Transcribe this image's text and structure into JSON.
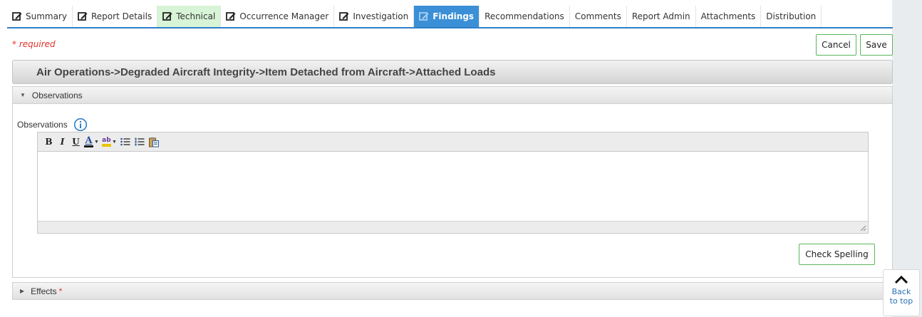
{
  "tabs": [
    {
      "label": "Summary",
      "icon": "edit-icon",
      "state": "normal"
    },
    {
      "label": "Report Details",
      "icon": "edit-icon",
      "state": "normal"
    },
    {
      "label": "Technical",
      "icon": "edit-icon",
      "state": "green"
    },
    {
      "label": "Occurrence Manager",
      "icon": "edit-icon",
      "state": "normal"
    },
    {
      "label": "Investigation",
      "icon": "edit-icon",
      "state": "normal"
    },
    {
      "label": "Findings",
      "icon": "edit-icon",
      "state": "active"
    },
    {
      "label": "Recommendations",
      "state": "normal"
    },
    {
      "label": "Comments",
      "state": "normal"
    },
    {
      "label": "Report Admin",
      "state": "normal"
    },
    {
      "label": "Attachments",
      "state": "normal"
    },
    {
      "label": "Distribution",
      "state": "normal"
    }
  ],
  "form": {
    "required_note": "* required",
    "cancel_label": "Cancel",
    "save_label": "Save",
    "category_path": "Air Operations->Degraded Aircraft Integrity->Item Detached from Aircraft->Attached Loads"
  },
  "observations_section": {
    "title": "Observations",
    "field_label": "Observations",
    "value": "",
    "check_spelling_label": "Check Spelling"
  },
  "editor_toolbar": {
    "bold": "B",
    "italic": "I",
    "underline": "U",
    "font_color": "A",
    "highlight": "ab",
    "tools": [
      "bold",
      "italic",
      "underline",
      "font-color",
      "highlight-color",
      "bulleted-list",
      "numbered-list",
      "paste"
    ]
  },
  "effects_section": {
    "title": "Effects",
    "required_marker": "*"
  },
  "back_to_top": {
    "label": "Back to top"
  },
  "colors": {
    "active_tab": "#3b8fd6",
    "completed_tab": "#d7f4d6",
    "required": "#e0302a",
    "button_border": "#5bb55b"
  }
}
